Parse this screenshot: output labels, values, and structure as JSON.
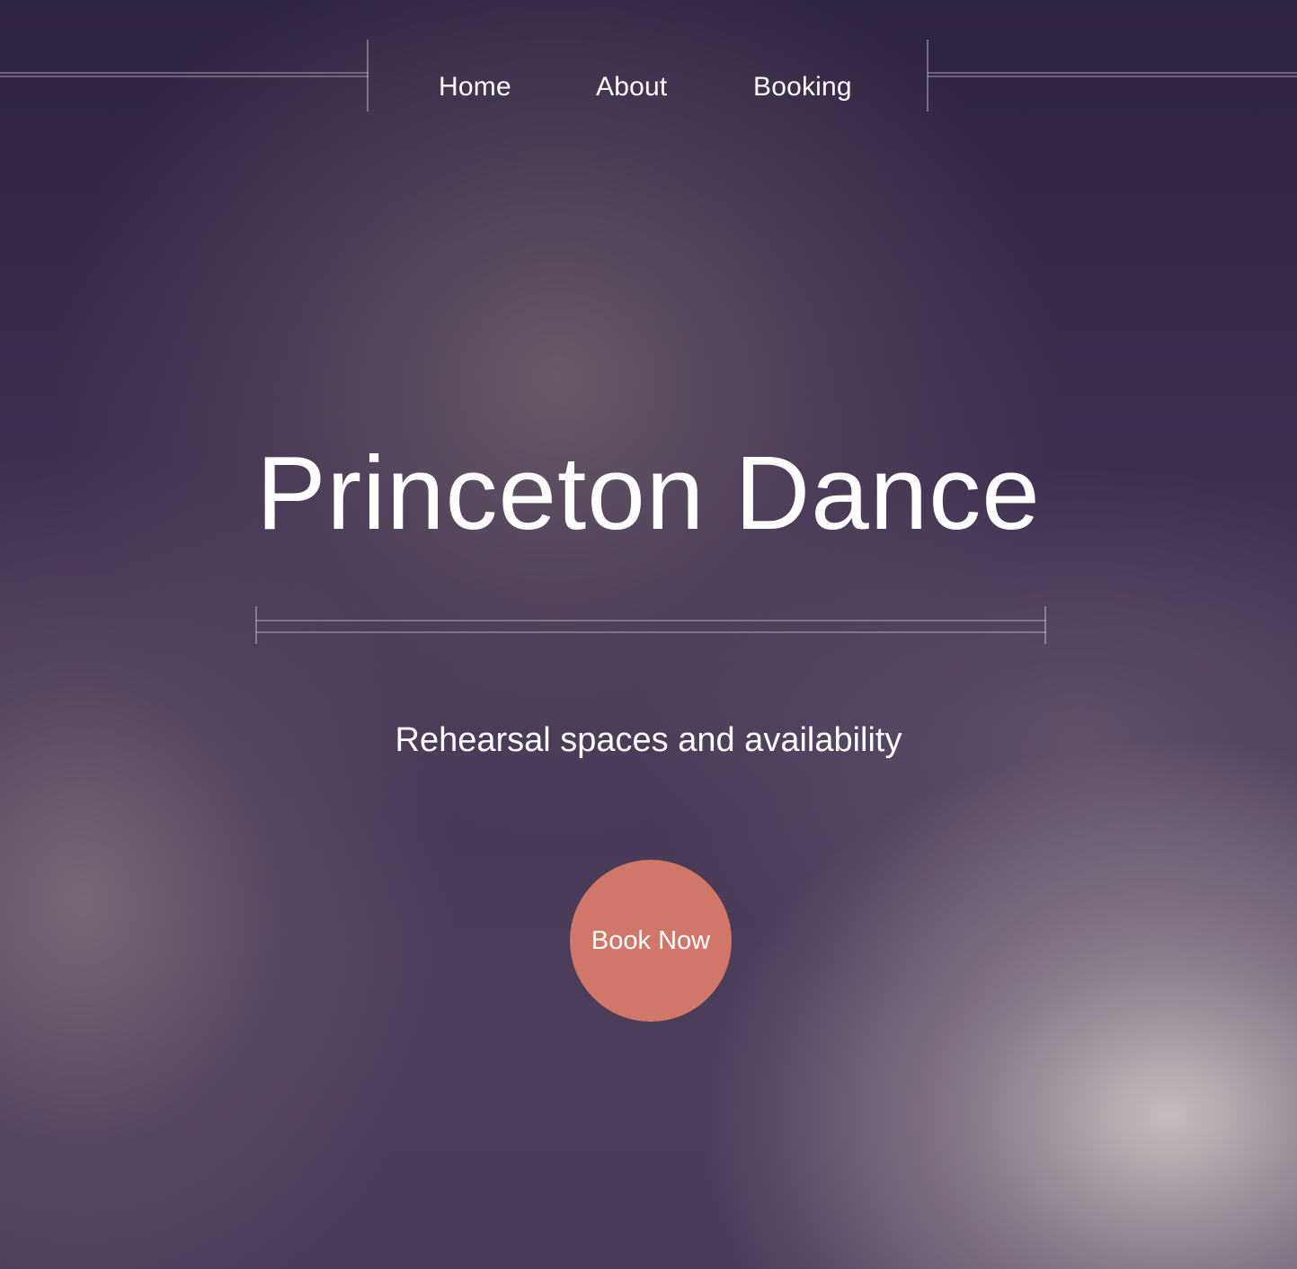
{
  "nav": {
    "items": [
      {
        "label": "Home"
      },
      {
        "label": "About"
      },
      {
        "label": "Booking"
      }
    ]
  },
  "hero": {
    "title": "Princeton Dance",
    "subtitle": "Rehearsal spaces and availability",
    "cta_label": "Book Now"
  },
  "colors": {
    "cta_background": "#d1776a",
    "text": "#ffffff",
    "background_base": "#3e2f4f"
  }
}
